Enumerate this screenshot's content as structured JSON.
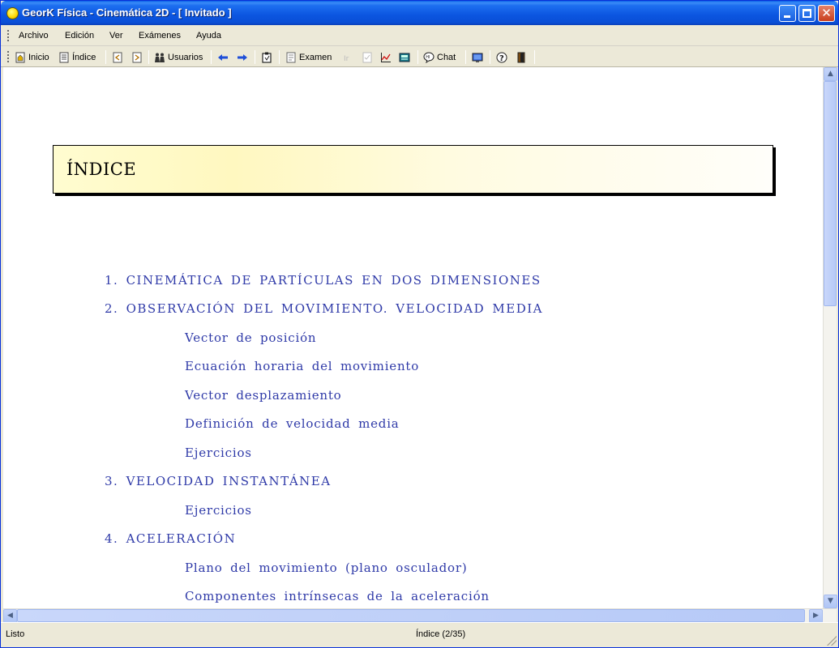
{
  "window": {
    "title": "GeorK Física - Cinemática 2D - [ Invitado ]"
  },
  "menu": {
    "items": [
      "Archivo",
      "Edición",
      "Ver",
      "Exámenes",
      "Ayuda"
    ]
  },
  "toolbar": {
    "inicio": "Inicio",
    "indice": "Índice",
    "usuarios": "Usuarios",
    "examen": "Examen",
    "chat": "Chat"
  },
  "page": {
    "title": "ÍNDICE",
    "toc": [
      {
        "label": "1.  CINEMÁTICA DE PARTÍCULAS EN DOS DIMENSIONES",
        "level": 1
      },
      {
        "label": "2.  OBSERVACIÓN DEL MOVIMIENTO. VELOCIDAD MEDIA",
        "level": 1
      },
      {
        "label": "Vector de posición",
        "level": 2
      },
      {
        "label": "Ecuación horaria del movimiento",
        "level": 2
      },
      {
        "label": "Vector desplazamiento",
        "level": 2
      },
      {
        "label": "Definición de velocidad media",
        "level": 2
      },
      {
        "label": "Ejercicios",
        "level": 2
      },
      {
        "label": "3.  VELOCIDAD INSTANTÁNEA",
        "level": 1
      },
      {
        "label": "Ejercicios",
        "level": 2
      },
      {
        "label": "4.  ACELERACIÓN",
        "level": 1
      },
      {
        "label": "Plano del movimiento (plano osculador)",
        "level": 2
      },
      {
        "label": "Componentes intrínsecas de la aceleración",
        "level": 2
      }
    ]
  },
  "status": {
    "left": "Listo",
    "page": "Índice (2/35)"
  },
  "colors": {
    "link": "#2f3aa8",
    "titlebar": "#0a4fd6",
    "header_bg": "#fff8c0"
  }
}
